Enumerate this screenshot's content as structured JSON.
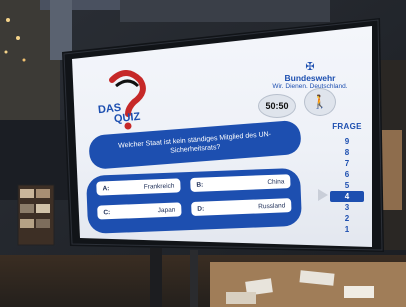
{
  "logo": {
    "line1": "DAS",
    "line2": "QUIZ"
  },
  "brand": {
    "name": "Bundeswehr",
    "slogan": "Wir. Dienen. Deutschland."
  },
  "lifelines": {
    "fifty": "50:50"
  },
  "question": "Welcher Staat ist kein ständiges Mitglied des UN-Sicherheitsrats?",
  "answers": [
    {
      "key": "A:",
      "text": "Frankreich"
    },
    {
      "key": "B:",
      "text": "China"
    },
    {
      "key": "C:",
      "text": "Japan"
    },
    {
      "key": "D:",
      "text": "Russland"
    }
  ],
  "ladder": {
    "label": "FRAGE",
    "steps": [
      "9",
      "8",
      "7",
      "6",
      "5",
      "4",
      "3",
      "2",
      "1"
    ],
    "current": "4"
  },
  "colors": {
    "quiz_blue": "#1d4fb0",
    "screen_bg": "#f1f3f8",
    "bezel": "#111418"
  }
}
